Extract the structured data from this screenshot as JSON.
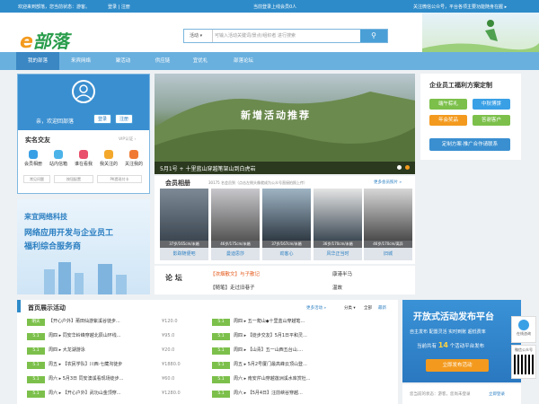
{
  "topbar": {
    "welcome": "欢迎来到部落，您当前状态：游客。",
    "login": "登录 | 注册",
    "online": "当前登录上线会员0人",
    "wechat": "关注微信公众号，平台各项主要功能随身在握 ▸"
  },
  "header": {
    "logo_e": "e",
    "logo_text": "部落",
    "search_select": "活动 ▾",
    "search_placeholder": "可输入活动关键词/景点/组织者 进行搜索"
  },
  "nav": [
    "我的部落",
    "来宾网络",
    "聚活动",
    "供应链",
    "宜优礼",
    "部落论坛"
  ],
  "user": {
    "greeting": "亲，欢迎回部落",
    "login": "登录",
    "register": "注册",
    "section": "实名交友",
    "vip": "VIP认证 ›",
    "icons": [
      "会员相册",
      "站内信箱",
      "谁在看我",
      "我关注的",
      "关注我的"
    ],
    "tags": [
      "常见问题",
      "按钮配置",
      "PK提现付卡"
    ]
  },
  "ad": {
    "company": "来宜网络科技",
    "line1": "网络应用开发与企业员工",
    "line2": "福利综合服务商"
  },
  "slide": {
    "caption": "5月1号 + 十里蓝山穿越笔架山到白虎岩",
    "title_text": "新增活动推荐"
  },
  "album": {
    "title": "会员相册",
    "sub": "30175 名会员到（点击左侧头像就成为公众号直接拍照上传）",
    "more": "更多会员照片 »",
    "items": [
      {
        "cap": "37岁/165cm/未婚",
        "name": "影踪随便吧"
      },
      {
        "cap": "46岁/175cm/未婚",
        "name": "曼迪思莎"
      },
      {
        "cap": "37岁/167cm/未婚",
        "name": "劲客心"
      },
      {
        "cap": "36岁/170cm/未婚",
        "name": "风华正当时"
      },
      {
        "cap": "46岁/170cm/离异",
        "name": "旧城"
      }
    ]
  },
  "forum": {
    "title": "论 坛",
    "items": [
      {
        "tag": "【浓烟散文】",
        "text": "与子散记"
      },
      {
        "tag": "",
        "text": "康港半马"
      },
      {
        "tag": "【随笔】",
        "text": "走过旧巷子"
      },
      {
        "tag": "",
        "text": "温故"
      }
    ]
  },
  "welfare": {
    "title": "企业员工福利方案定制",
    "buttons": [
      "端午粽礼",
      "中秋博饼",
      "年会奖品",
      "答谢客户"
    ],
    "cta": "定制方案·推广合作请联系"
  },
  "activities": {
    "title": "首页展示活动",
    "more": "更多活动 »",
    "filters": [
      "分类 ▾",
      "全部",
      "最新"
    ],
    "rows": [
      {
        "tag": "明天",
        "text": "【开心户外】莆田仙游紫溪谷徒步...",
        "price": "¥120.0",
        "tag2": "5.1",
        "text2": "周四 ▸ 五一爬山◆十里蓝山穿越笔..."
      },
      {
        "tag": "5.1",
        "text": "周四 ▸ 同安华岭峰穿越北辰山环线...",
        "price": "¥95.0",
        "tag2": "5.1",
        "text2": "周四 ▸ 【徒步交友】5月1日平和灵..."
      },
      {
        "tag": "5.1",
        "text": "周四 ▸ 大龙湖游泳",
        "price": "¥20.0",
        "tag2": "5.1",
        "text2": "周四 ▸ 【山青】五一山西五台山...."
      },
      {
        "tag": "5.1",
        "text": "周五 ▸ 【农民学队】川西·七藏沟徒步",
        "price": "¥1880.0",
        "tag2": "5.1",
        "text2": "周五 ▸ 5月2号厦门最高峰云顶山登..."
      },
      {
        "tag": "5.1",
        "text": "周六 ▸ 5月3日 同安澳溪看现场徒步...",
        "price": "¥60.0",
        "tag2": "5.1",
        "text2": "周六 ▸ 南安芹山穿越莲洲溪水库赏杜..."
      },
      {
        "tag": "5.1",
        "text": "周六 ▸ 【开心户外】武功山金顶穿...",
        "price": "¥1280.0",
        "tag2": "5.1",
        "text2": "周六 ▸ 【5月4日】汪前峡谷穿越..."
      }
    ]
  },
  "publish": {
    "title": "开放式活动发布平台",
    "row": "自主发布  配置灵活  实时到账  超低费率",
    "stat_pre": "当前共有",
    "count": "14",
    "stat_post": "个活动平台发布",
    "cta": "立即发布活动"
  },
  "side": {
    "online": "在线咨询",
    "wechat": "微信公众号"
  },
  "footer": {
    "tip": "您当前的状态：游客，您尚未登录",
    "login": "立即登录"
  },
  "colors": {
    "primary": "#2e8bc9",
    "orange": "#f39a1e",
    "green": "#7cc04b"
  }
}
